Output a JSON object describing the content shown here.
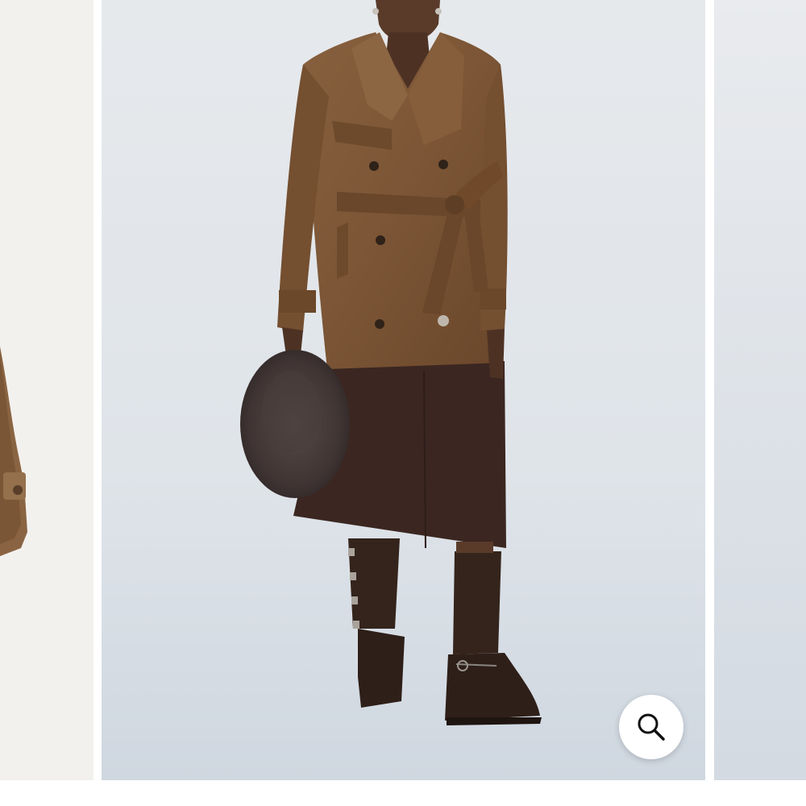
{
  "gallery": {
    "slides": [
      {
        "id": "previous",
        "subject": "suede-coat-sleeve-detail"
      },
      {
        "id": "current",
        "subject": "model-in-belted-suede-trench-coat"
      },
      {
        "id": "next",
        "subject": "studio-backdrop"
      }
    ],
    "active_index": 1
  },
  "zoom_button": {
    "icon": "magnifier-icon"
  },
  "colors": {
    "backdrop": "#e2e6ea",
    "coat": "#7b5535",
    "skirt": "#3b2621",
    "boots": "#34241c",
    "fur_bag": "#3f3433"
  }
}
